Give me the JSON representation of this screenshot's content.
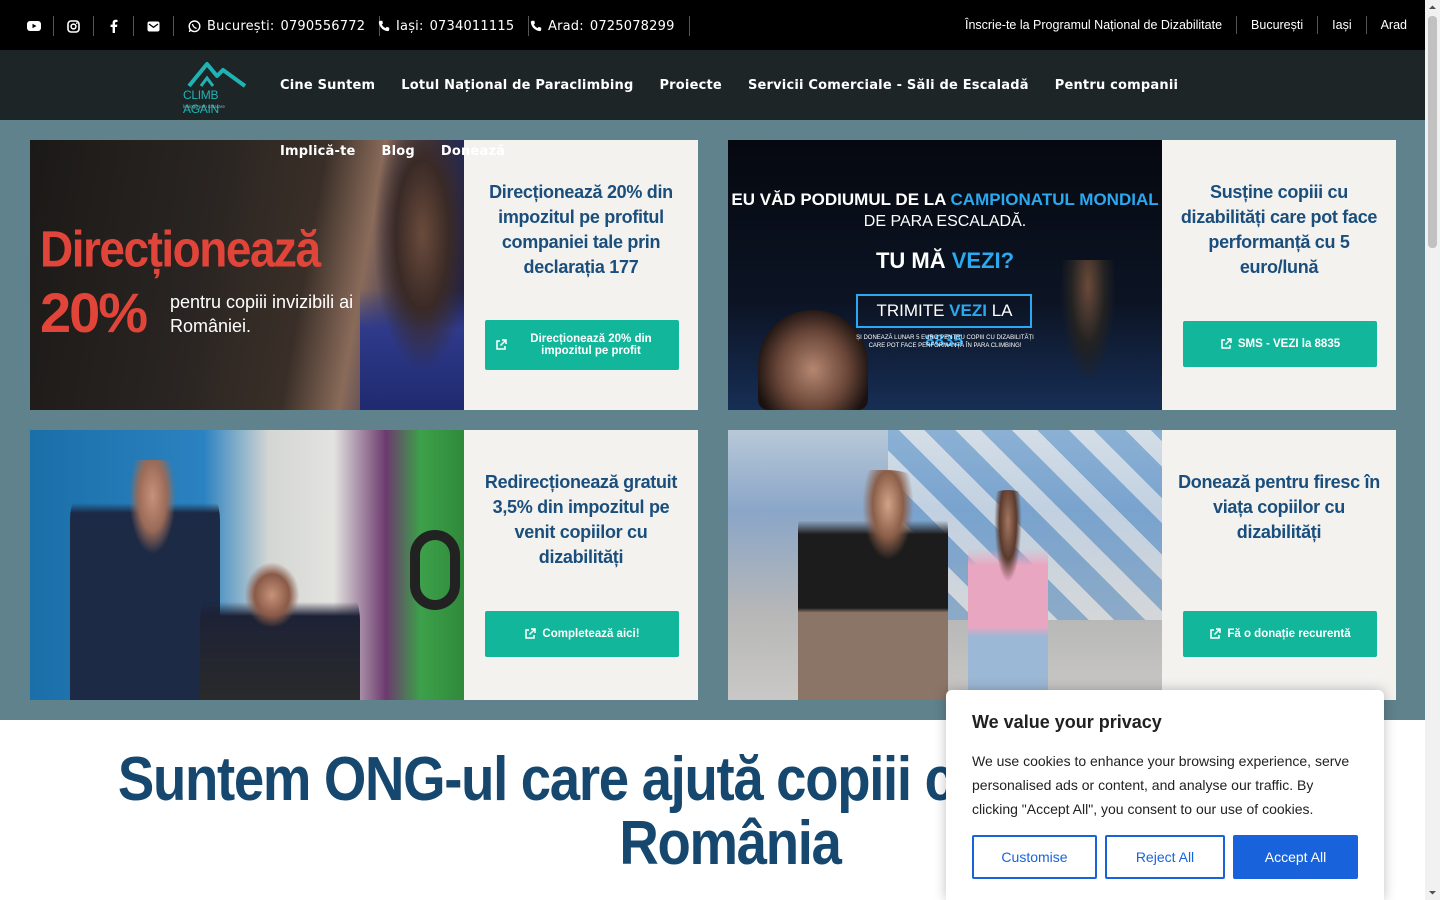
{
  "topbar": {
    "phones": [
      {
        "city": "București:",
        "number": "0790556772",
        "icon": "whatsapp-icon"
      },
      {
        "city": "Iași:",
        "number": "0734011115",
        "icon": "phone-icon"
      },
      {
        "city": "Arad:",
        "number": "0725078299",
        "icon": "phone-icon"
      }
    ],
    "social_icons": [
      "youtube-icon",
      "instagram-icon",
      "facebook-icon",
      "email-icon"
    ],
    "links": [
      "Înscrie-te la Programul Național de Dizabilitate",
      "București",
      "Iași",
      "Arad"
    ]
  },
  "nav": {
    "logo_text": "CLIMB AGAIN",
    "logo_sub": "învinge prin catarare",
    "menu": [
      "Cine Suntem",
      "Lotul Național de Paraclimbing",
      "Proiecte",
      "Servicii Comerciale - Săli de Escaladă",
      "Pentru companii"
    ],
    "menu2": [
      "Implică-te",
      "Blog",
      "Donează"
    ]
  },
  "cards": [
    {
      "title": "Direcționează 20% din impozitul pe profitul companiei tale prin declarația 177",
      "button": "Direcționează 20% din impozitul pe profit",
      "image_text": {
        "line1": "Direcționează",
        "line2": "20%",
        "line3": "pentru copiii invizibili ai României."
      }
    },
    {
      "title": "Susține copiii cu dizabilități care pot face performanță cu 5 euro/lună",
      "button": "SMS - VEZI la 8835",
      "image_text": {
        "line1a": "EU VĂD PODIUMUL DE LA",
        "line1b": "CAMPIONATUL MONDIAL",
        "line2": "DE PARA ESCALADĂ.",
        "line3a": "TU MĂ",
        "line3b": "VEZI?",
        "box_a": "TRIMITE",
        "box_b": "VEZI",
        "box_c": "LA",
        "box_d": "8835",
        "small": "ȘI DONEAZĂ LUNAR 5 EURO PENTRU COPIII CU DIZABILITĂȚI CARE POT FACE PERFORMANȚĂ ÎN PARA CLIMBING!"
      }
    },
    {
      "title": "Redirecționează gratuit 3,5% din impozitul pe venit copiilor cu dizabilități",
      "button": "Completează aici!"
    },
    {
      "title": "Donează pentru firesc în viața copiilor cu dizabilități",
      "button": "Fă o donație recurentă"
    }
  ],
  "headline": "Suntem ONG-ul care ajută copiii cu dizabilități din România",
  "cookie": {
    "title": "We value your privacy",
    "text": "We use cookies to enhance your browsing experience, serve personalised ads or content, and analyse our traffic. By clicking \"Accept All\", you consent to our use of cookies.",
    "customise": "Customise",
    "reject": "Reject All",
    "accept": "Accept All"
  },
  "colors": {
    "topbar": "#000000",
    "nav": "#1e2527",
    "band": "#5f828c",
    "button": "#12b69a",
    "title": "#1a4e7c",
    "cookie_accent": "#1863dc"
  }
}
